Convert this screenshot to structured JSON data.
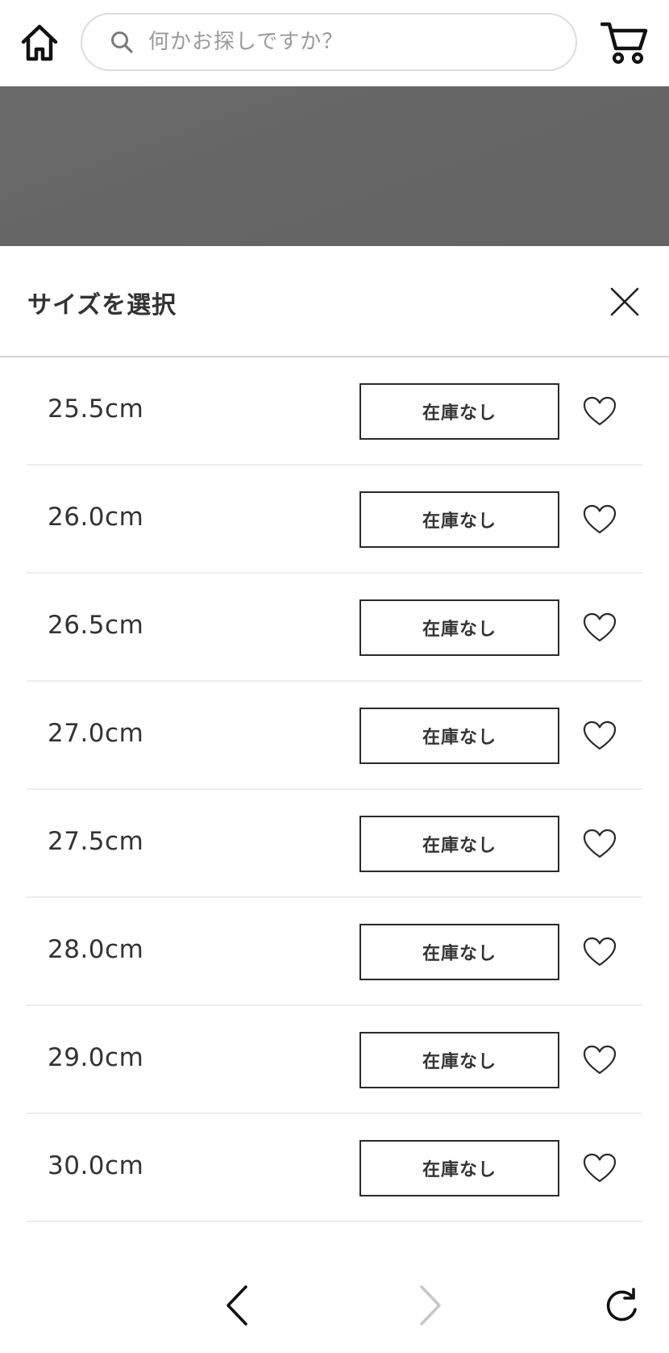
{
  "header": {
    "home_icon": "home-icon",
    "search": {
      "placeholder": "何かお探しですか？",
      "value": "",
      "icon": "search-icon"
    },
    "cart_icon": "cart-icon"
  },
  "size_sheet": {
    "title": "サイズを選択",
    "close_icon": "close-icon",
    "sizes": [
      {
        "size": "25.5cm",
        "status": "在庫なし"
      },
      {
        "size": "26.0cm",
        "status": "在庫なし"
      },
      {
        "size": "26.5cm",
        "status": "在庫なし"
      },
      {
        "size": "27.0cm",
        "status": "在庫なし"
      },
      {
        "size": "27.5cm",
        "status": "在庫なし"
      },
      {
        "size": "28.0cm",
        "status": "在庫なし"
      },
      {
        "size": "29.0cm",
        "status": "在庫なし"
      },
      {
        "size": "30.0cm",
        "status": "在庫なし"
      }
    ]
  },
  "toolbar": {
    "back_icon": "chevron-left-icon",
    "forward_icon": "chevron-right-icon",
    "reload_icon": "reload-icon",
    "forward_enabled": false
  },
  "colors": {
    "text": "#333333",
    "border": "#2a2a2a",
    "divider": "#ececec",
    "overlay": "#666666",
    "disabled": "#c8c8c8"
  }
}
